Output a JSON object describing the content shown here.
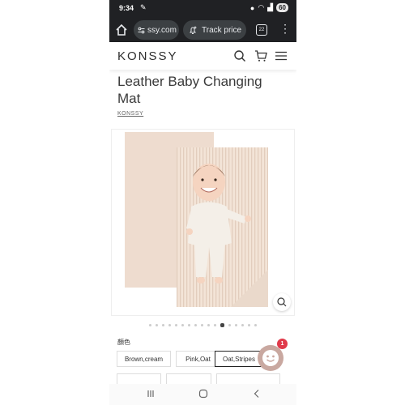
{
  "status_bar": {
    "time": "9:34",
    "battery": "60"
  },
  "browser": {
    "url": "ssy.com",
    "track_price_label": "Track price",
    "tab_count": "22"
  },
  "site": {
    "logo": "KONSSY"
  },
  "product": {
    "title": "Leather Baby Changing Mat",
    "brand": "KONSSY",
    "image_count": 17,
    "active_image_index": 11
  },
  "options": {
    "label": "顏色",
    "items": [
      "Brown,cream",
      "Pink,Oat",
      "Oat,Stripes"
    ],
    "selected": "Oat,Stripes"
  },
  "chat": {
    "badge_count": "1"
  },
  "colors": {
    "mat_back": "#eedccf",
    "mat_front": "#f3e4d7",
    "chrome_dark": "#202124",
    "badge": "#e03a4a"
  }
}
